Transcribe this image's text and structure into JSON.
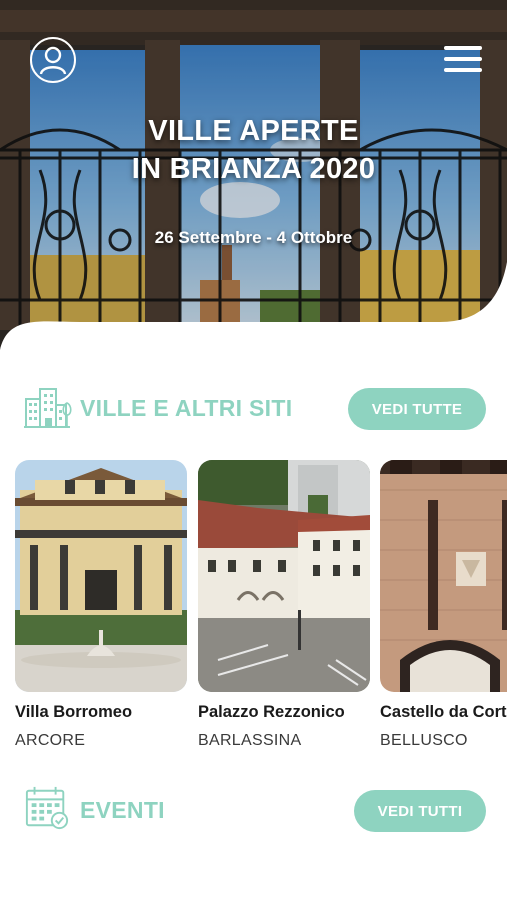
{
  "hero": {
    "title_line1": "VILLE APERTE",
    "title_line2": "IN BRIANZA 2020",
    "dates": "26 Settembre - 4 Ottobre"
  },
  "icons": {
    "profile": "user-circle-icon",
    "menu": "hamburger-menu-icon",
    "buildings": "buildings-icon",
    "calendar": "calendar-check-icon"
  },
  "sites_section": {
    "title": "VILLE E ALTRI SITI",
    "see_all_label": "VEDI TUTTE",
    "items": [
      {
        "name": "Villa Borromeo",
        "place": "ARCORE"
      },
      {
        "name": "Palazzo Rezzonico",
        "place": "BARLASSINA"
      },
      {
        "name": "Castello da Corte",
        "place": "BELLUSCO"
      }
    ]
  },
  "events_section": {
    "title": "EVENTI",
    "see_all_label": "VEDI TUTTI"
  },
  "colors": {
    "accent": "#8ed3c0",
    "text_dark": "#1a1a1a",
    "background": "#ffffff"
  }
}
